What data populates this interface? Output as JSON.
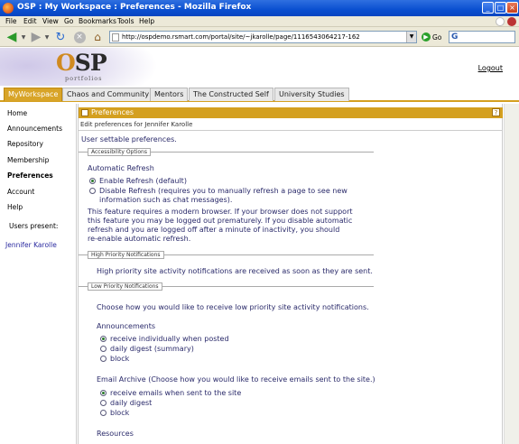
{
  "window": {
    "title": "OSP : My Workspace : Preferences - Mozilla Firefox"
  },
  "menu": [
    "File",
    "Edit",
    "View",
    "Go",
    "Bookmarks",
    "Tools",
    "Help"
  ],
  "toolbar": {
    "url": "http://ospdemo.rsmart.com/portal/site/~jkarolle/page/1116543064217-162",
    "go_label": "Go"
  },
  "header": {
    "logo_text": "OSP",
    "logo_sub": "portfolios",
    "logout": "Logout"
  },
  "tabs": [
    "MyWorkspace",
    "Chaos and Community",
    "Mentors",
    "The Constructed Self",
    "University Studies"
  ],
  "sidebar": {
    "items": [
      "Home",
      "Announcements",
      "Repository",
      "Membership",
      "Preferences",
      "Account",
      "Help"
    ],
    "users_present_label": "Users present:",
    "users": [
      "Jennifer Karolle"
    ]
  },
  "tool": {
    "title": "Preferences",
    "help": "?",
    "breadcrumb": "Edit preferences for Jennifer Karolle",
    "intro": "User settable preferences."
  },
  "accessibility": {
    "legend": "Accessibility Options",
    "heading": "Automatic Refresh",
    "opt1": "Enable Refresh (default)",
    "opt2_line1": "Disable Refresh (requires you to manually refresh a page to see new",
    "opt2_line2": "information such as chat messages).",
    "note1": "This feature requires a modern browser. If your browser does not support",
    "note2": "this feature you may be logged out prematurely. If you disable automatic",
    "note3": "refresh and you are logged off after a minute of inactivity, you should",
    "note4": "re-enable automatic refresh."
  },
  "high_priority": {
    "legend": "High Priority Notifications",
    "text": "High priority site activity notifications are received as soon as they are sent."
  },
  "low_priority": {
    "legend": "Low Priority Notifications",
    "intro": "Choose how you would like to receive low priority site activity notifications.",
    "announcements": {
      "heading": "Announcements",
      "opts": [
        "receive individually when posted",
        "daily digest (summary)",
        "block"
      ]
    },
    "email_archive": {
      "heading": "Email Archive (Choose how you would like to receive emails sent to the site.)",
      "opts": [
        "receive emails when sent to the site",
        "daily digest",
        "block"
      ]
    },
    "resources_heading": "Resources"
  }
}
